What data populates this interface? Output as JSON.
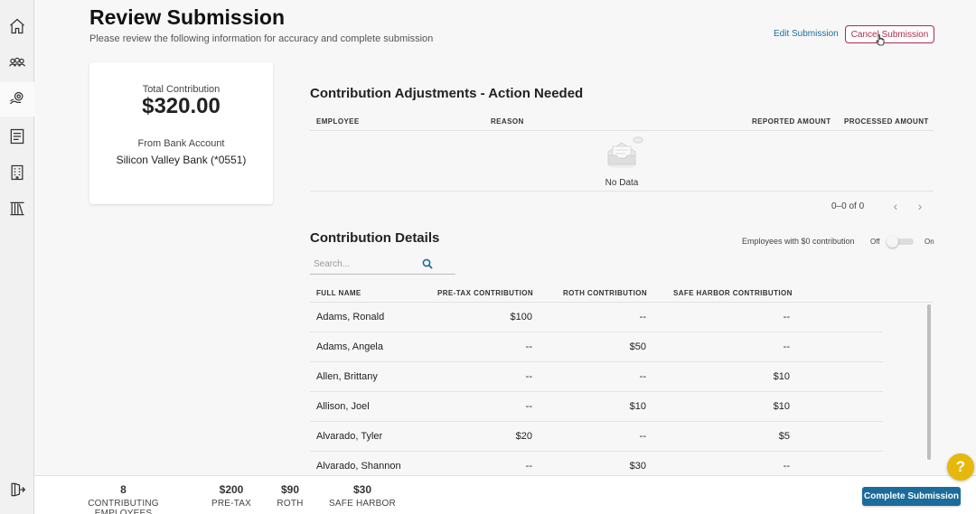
{
  "sidebar": {
    "items": [
      {
        "icon": "home-icon"
      },
      {
        "icon": "people-icon"
      },
      {
        "icon": "hand-coin-icon"
      },
      {
        "icon": "document-list-icon"
      },
      {
        "icon": "building-icon"
      },
      {
        "icon": "library-icon"
      }
    ],
    "bottom_icon": "logout-icon"
  },
  "header": {
    "title": "Review Submission",
    "subtitle": "Please review the following information for accuracy and complete submission",
    "edit_label": "Edit Submission",
    "cancel_label": "Cancel Submission"
  },
  "summary": {
    "total_label": "Total Contribution",
    "total_amount": "$320.00",
    "bank_label": "From Bank Account",
    "bank_value": "Silicon Valley Bank (*0551)"
  },
  "adjustments": {
    "title": "Contribution Adjustments - Action Needed",
    "columns": [
      "EMPLOYEE",
      "REASON",
      "REPORTED AMOUNT",
      "PROCESSED AMOUNT"
    ],
    "empty_text": "No Data",
    "pagination": "0–0 of 0"
  },
  "details": {
    "title": "Contribution Details",
    "toggle_label": "Employees with $0 contribution",
    "toggle_off": "Off",
    "toggle_on": "On",
    "toggle_value": "Off",
    "search_placeholder": "Search...",
    "columns": [
      "FULL NAME",
      "PRE-TAX CONTRIBUTION",
      "ROTH CONTRIBUTION",
      "SAFE HARBOR CONTRIBUTION"
    ],
    "rows": [
      {
        "name": "Adams, Ronald",
        "pretax": "$100",
        "roth": "--",
        "safe": "--"
      },
      {
        "name": "Adams, Angela",
        "pretax": "--",
        "roth": "$50",
        "safe": "--"
      },
      {
        "name": "Allen, Brittany",
        "pretax": "--",
        "roth": "--",
        "safe": "$10"
      },
      {
        "name": "Allison, Joel",
        "pretax": "--",
        "roth": "$10",
        "safe": "$10"
      },
      {
        "name": "Alvarado, Tyler",
        "pretax": "$20",
        "roth": "--",
        "safe": "$5"
      },
      {
        "name": "Alvarado, Shannon",
        "pretax": "--",
        "roth": "$30",
        "safe": "--"
      }
    ]
  },
  "footer": {
    "stats": [
      {
        "value": "8",
        "label": "CONTRIBUTING EMPLOYEES"
      },
      {
        "value": "$200",
        "label": "PRE-TAX"
      },
      {
        "value": "$90",
        "label": "ROTH"
      },
      {
        "value": "$30",
        "label": "SAFE HARBOR"
      }
    ],
    "complete_label": "Complete Submission",
    "help_label": "?"
  },
  "colors": {
    "primary": "#1b6c9b",
    "cancel": "#b02a4a",
    "help": "#e5b80b"
  }
}
